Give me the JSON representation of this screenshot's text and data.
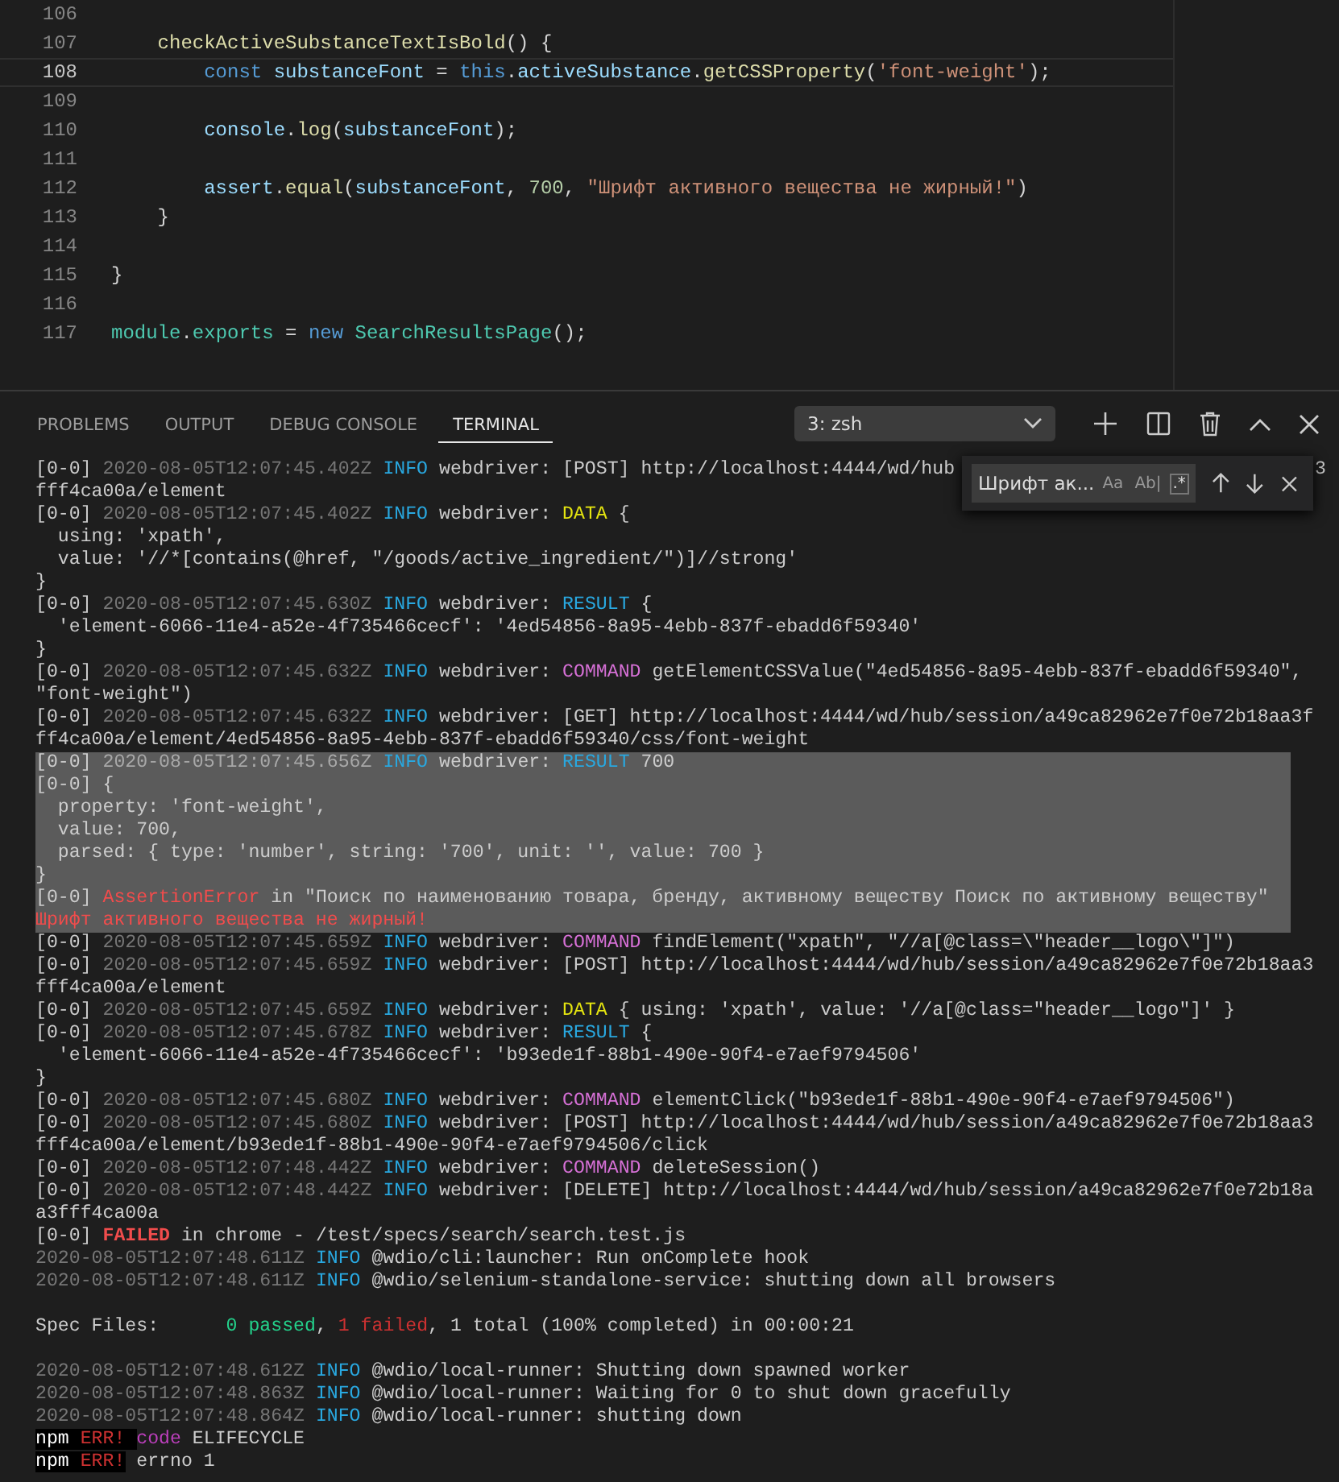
{
  "editor": {
    "lines": [
      {
        "number": "106",
        "current": false
      },
      {
        "number": "107",
        "current": false,
        "tokens": [
          {
            "kind": "fn",
            "text": "    checkActiveSubstanceTextIsBold"
          },
          {
            "kind": "plain",
            "text": "() {"
          }
        ]
      },
      {
        "number": "108",
        "current": true,
        "tokens": [
          {
            "kind": "kw",
            "text": "        const "
          },
          {
            "kind": "var",
            "text": "substanceFont"
          },
          {
            "kind": "plain",
            "text": " = "
          },
          {
            "kind": "kw",
            "text": "this"
          },
          {
            "kind": "plain",
            "text": "."
          },
          {
            "kind": "var",
            "text": "activeSubstance"
          },
          {
            "kind": "plain",
            "text": "."
          },
          {
            "kind": "fn",
            "text": "getCSSProperty"
          },
          {
            "kind": "plain",
            "text": "("
          },
          {
            "kind": "str",
            "text": "'font-weight'"
          },
          {
            "kind": "plain",
            "text": ");"
          }
        ]
      },
      {
        "number": "109",
        "current": false
      },
      {
        "number": "110",
        "current": false,
        "tokens": [
          {
            "kind": "var",
            "text": "        console"
          },
          {
            "kind": "plain",
            "text": "."
          },
          {
            "kind": "fn",
            "text": "log"
          },
          {
            "kind": "plain",
            "text": "("
          },
          {
            "kind": "var",
            "text": "substanceFont"
          },
          {
            "kind": "plain",
            "text": ");"
          }
        ]
      },
      {
        "number": "111",
        "current": false
      },
      {
        "number": "112",
        "current": false,
        "tokens": [
          {
            "kind": "var",
            "text": "        assert"
          },
          {
            "kind": "plain",
            "text": "."
          },
          {
            "kind": "fn",
            "text": "equal"
          },
          {
            "kind": "plain",
            "text": "("
          },
          {
            "kind": "var",
            "text": "substanceFont"
          },
          {
            "kind": "plain",
            "text": ", "
          },
          {
            "kind": "num",
            "text": "700"
          },
          {
            "kind": "plain",
            "text": ", "
          },
          {
            "kind": "str",
            "text": "\"Шрифт активного вещества не жирный!\""
          },
          {
            "kind": "plain",
            "text": ")"
          }
        ]
      },
      {
        "number": "113",
        "current": false,
        "tokens": [
          {
            "kind": "plain",
            "text": "    }"
          }
        ]
      },
      {
        "number": "114",
        "current": false
      },
      {
        "number": "115",
        "current": false,
        "tokens": [
          {
            "kind": "plain",
            "text": "}"
          }
        ]
      },
      {
        "number": "116",
        "current": false
      },
      {
        "number": "117",
        "current": false,
        "tokens": [
          {
            "kind": "cls",
            "text": "module"
          },
          {
            "kind": "plain",
            "text": "."
          },
          {
            "kind": "cls",
            "text": "exports"
          },
          {
            "kind": "plain",
            "text": " = "
          },
          {
            "kind": "kw",
            "text": "new "
          },
          {
            "kind": "cls",
            "text": "SearchResultsPage"
          },
          {
            "kind": "plain",
            "text": "();"
          }
        ]
      }
    ]
  },
  "panel": {
    "tabs": [
      {
        "label": "PROBLEMS",
        "selected": false
      },
      {
        "label": "OUTPUT",
        "selected": false
      },
      {
        "label": "DEBUG CONSOLE",
        "selected": false
      },
      {
        "label": "TERMINAL",
        "selected": true
      }
    ],
    "terminal_select": "3: zsh",
    "find": {
      "value": "Шрифт ак...",
      "options": [
        {
          "label": "Aa",
          "on": false
        },
        {
          "label": "Ab|",
          "on": false
        },
        {
          "label": ".*",
          "on": true
        }
      ]
    },
    "terminal": [
      {
        "kind": "text",
        "highlighted": false,
        "segments": [
          {
            "kind": "plain",
            "text": "[0-0] "
          },
          {
            "kind": "dim",
            "text": "2020-08-05T12:07:45.402Z "
          },
          {
            "kind": "info",
            "text": "INFO"
          },
          {
            "kind": "plain",
            "text": " webdriver: [POST] http://localhost:4444/wd/hub"
          }
        ],
        "tail": "3"
      },
      {
        "kind": "text",
        "highlighted": false,
        "segments": [
          {
            "kind": "plain",
            "text": "fff4ca00a/element"
          }
        ]
      },
      {
        "kind": "text",
        "highlighted": false,
        "segments": [
          {
            "kind": "plain",
            "text": "[0-0] "
          },
          {
            "kind": "dim",
            "text": "2020-08-05T12:07:45.402Z "
          },
          {
            "kind": "info",
            "text": "INFO"
          },
          {
            "kind": "plain",
            "text": " webdriver: "
          },
          {
            "kind": "data",
            "text": "DATA"
          },
          {
            "kind": "plain",
            "text": " {"
          }
        ]
      },
      {
        "kind": "text",
        "highlighted": false,
        "segments": [
          {
            "kind": "plain",
            "text": "  using: 'xpath',"
          }
        ]
      },
      {
        "kind": "text",
        "highlighted": false,
        "segments": [
          {
            "kind": "plain",
            "text": "  value: '//*[contains(@href, \"/goods/active_ingredient/\")]//strong'"
          }
        ]
      },
      {
        "kind": "text",
        "highlighted": false,
        "segments": [
          {
            "kind": "plain",
            "text": "}"
          }
        ]
      },
      {
        "kind": "text",
        "highlighted": false,
        "segments": [
          {
            "kind": "plain",
            "text": "[0-0] "
          },
          {
            "kind": "dim",
            "text": "2020-08-05T12:07:45.630Z "
          },
          {
            "kind": "info",
            "text": "INFO"
          },
          {
            "kind": "plain",
            "text": " webdriver: "
          },
          {
            "kind": "info",
            "text": "RESULT"
          },
          {
            "kind": "plain",
            "text": " {"
          }
        ]
      },
      {
        "kind": "text",
        "highlighted": false,
        "segments": [
          {
            "kind": "plain",
            "text": "  'element-6066-11e4-a52e-4f735466cecf': '4ed54856-8a95-4ebb-837f-ebadd6f59340'"
          }
        ]
      },
      {
        "kind": "text",
        "highlighted": false,
        "segments": [
          {
            "kind": "plain",
            "text": "}"
          }
        ]
      },
      {
        "kind": "text",
        "highlighted": false,
        "segments": [
          {
            "kind": "plain",
            "text": "[0-0] "
          },
          {
            "kind": "dim",
            "text": "2020-08-05T12:07:45.632Z "
          },
          {
            "kind": "info",
            "text": "INFO"
          },
          {
            "kind": "plain",
            "text": " webdriver: "
          },
          {
            "kind": "cmd",
            "text": "COMMAND"
          },
          {
            "kind": "plain",
            "text": " getElementCSSValue(\"4ed54856-8a95-4ebb-837f-ebadd6f59340\","
          }
        ]
      },
      {
        "kind": "text",
        "highlighted": false,
        "segments": [
          {
            "kind": "plain",
            "text": "\"font-weight\")"
          }
        ]
      },
      {
        "kind": "text",
        "highlighted": false,
        "segments": [
          {
            "kind": "plain",
            "text": "[0-0] "
          },
          {
            "kind": "dim",
            "text": "2020-08-05T12:07:45.632Z "
          },
          {
            "kind": "info",
            "text": "INFO"
          },
          {
            "kind": "plain",
            "text": " webdriver: [GET] http://localhost:4444/wd/hub/session/a49ca82962e7f0e72b18aa3f"
          }
        ]
      },
      {
        "kind": "text",
        "highlighted": false,
        "segments": [
          {
            "kind": "plain",
            "text": "ff4ca00a/element/4ed54856-8a95-4ebb-837f-ebadd6f59340/css/font-weight"
          }
        ]
      },
      {
        "kind": "text",
        "highlighted": true,
        "segments": [
          {
            "kind": "plain",
            "text": "[0-0] "
          },
          {
            "kind": "dim",
            "text": "2020-08-05T12:07:45.656Z "
          },
          {
            "kind": "info",
            "text": "INFO"
          },
          {
            "kind": "plain",
            "text": " webdriver: "
          },
          {
            "kind": "info",
            "text": "RESULT"
          },
          {
            "kind": "plain",
            "text": " 700"
          }
        ]
      },
      {
        "kind": "text",
        "highlighted": true,
        "segments": [
          {
            "kind": "plain",
            "text": "[0-0] {"
          }
        ]
      },
      {
        "kind": "text",
        "highlighted": true,
        "segments": [
          {
            "kind": "plain",
            "text": "  property: 'font-weight',"
          }
        ]
      },
      {
        "kind": "text",
        "highlighted": true,
        "segments": [
          {
            "kind": "plain",
            "text": "  value: 700,"
          }
        ]
      },
      {
        "kind": "text",
        "highlighted": true,
        "segments": [
          {
            "kind": "plain",
            "text": "  parsed: { type: 'number', string: '700', unit: '', value: 700 }"
          }
        ]
      },
      {
        "kind": "text",
        "highlighted": true,
        "segments": [
          {
            "kind": "plain",
            "text": "}"
          }
        ]
      },
      {
        "kind": "text",
        "highlighted": true,
        "segments": [
          {
            "kind": "plain",
            "text": "[0-0] "
          },
          {
            "kind": "error",
            "text": "AssertionError"
          },
          {
            "kind": "plain",
            "text": " in \"Поиск по наименованию товара, бренду, активному веществу Поиск по активному веществу\""
          }
        ]
      },
      {
        "kind": "text",
        "highlighted": true,
        "segments": [
          {
            "kind": "error",
            "text": "Шрифт активного вещества не жирный!"
          }
        ]
      },
      {
        "kind": "text",
        "highlighted": false,
        "segments": [
          {
            "kind": "plain",
            "text": "[0-0] "
          },
          {
            "kind": "dim",
            "text": "2020-08-05T12:07:45.659Z "
          },
          {
            "kind": "info",
            "text": "INFO"
          },
          {
            "kind": "plain",
            "text": " webdriver: "
          },
          {
            "kind": "cmd",
            "text": "COMMAND"
          },
          {
            "kind": "plain",
            "text": " findElement(\"xpath\", \"//a[@class=\\\"header__logo\\\"]\")"
          }
        ]
      },
      {
        "kind": "text",
        "highlighted": false,
        "segments": [
          {
            "kind": "plain",
            "text": "[0-0] "
          },
          {
            "kind": "dim",
            "text": "2020-08-05T12:07:45.659Z "
          },
          {
            "kind": "info",
            "text": "INFO"
          },
          {
            "kind": "plain",
            "text": " webdriver: [POST] http://localhost:4444/wd/hub/session/a49ca82962e7f0e72b18aa3"
          }
        ]
      },
      {
        "kind": "text",
        "highlighted": false,
        "segments": [
          {
            "kind": "plain",
            "text": "fff4ca00a/element"
          }
        ]
      },
      {
        "kind": "text",
        "highlighted": false,
        "segments": [
          {
            "kind": "plain",
            "text": "[0-0] "
          },
          {
            "kind": "dim",
            "text": "2020-08-05T12:07:45.659Z "
          },
          {
            "kind": "info",
            "text": "INFO"
          },
          {
            "kind": "plain",
            "text": " webdriver: "
          },
          {
            "kind": "data",
            "text": "DATA"
          },
          {
            "kind": "plain",
            "text": " { using: 'xpath', value: '//a[@class=\"header__logo\"]' }"
          }
        ]
      },
      {
        "kind": "text",
        "highlighted": false,
        "segments": [
          {
            "kind": "plain",
            "text": "[0-0] "
          },
          {
            "kind": "dim",
            "text": "2020-08-05T12:07:45.678Z "
          },
          {
            "kind": "info",
            "text": "INFO"
          },
          {
            "kind": "plain",
            "text": " webdriver: "
          },
          {
            "kind": "info",
            "text": "RESULT"
          },
          {
            "kind": "plain",
            "text": " {"
          }
        ]
      },
      {
        "kind": "text",
        "highlighted": false,
        "segments": [
          {
            "kind": "plain",
            "text": "  'element-6066-11e4-a52e-4f735466cecf': 'b93ede1f-88b1-490e-90f4-e7aef9794506'"
          }
        ]
      },
      {
        "kind": "text",
        "highlighted": false,
        "segments": [
          {
            "kind": "plain",
            "text": "}"
          }
        ]
      },
      {
        "kind": "text",
        "highlighted": false,
        "segments": [
          {
            "kind": "plain",
            "text": "[0-0] "
          },
          {
            "kind": "dim",
            "text": "2020-08-05T12:07:45.680Z "
          },
          {
            "kind": "info",
            "text": "INFO"
          },
          {
            "kind": "plain",
            "text": " webdriver: "
          },
          {
            "kind": "cmd",
            "text": "COMMAND"
          },
          {
            "kind": "plain",
            "text": " elementClick(\"b93ede1f-88b1-490e-90f4-e7aef9794506\")"
          }
        ]
      },
      {
        "kind": "text",
        "highlighted": false,
        "segments": [
          {
            "kind": "plain",
            "text": "[0-0] "
          },
          {
            "kind": "dim",
            "text": "2020-08-05T12:07:45.680Z "
          },
          {
            "kind": "info",
            "text": "INFO"
          },
          {
            "kind": "plain",
            "text": " webdriver: [POST] http://localhost:4444/wd/hub/session/a49ca82962e7f0e72b18aa3"
          }
        ]
      },
      {
        "kind": "text",
        "highlighted": false,
        "segments": [
          {
            "kind": "plain",
            "text": "fff4ca00a/element/b93ede1f-88b1-490e-90f4-e7aef9794506/click"
          }
        ]
      },
      {
        "kind": "text",
        "highlighted": false,
        "segments": [
          {
            "kind": "plain",
            "text": "[0-0] "
          },
          {
            "kind": "dim",
            "text": "2020-08-05T12:07:48.442Z "
          },
          {
            "kind": "info",
            "text": "INFO"
          },
          {
            "kind": "plain",
            "text": " webdriver: "
          },
          {
            "kind": "cmd",
            "text": "COMMAND"
          },
          {
            "kind": "plain",
            "text": " deleteSession()"
          }
        ]
      },
      {
        "kind": "text",
        "highlighted": false,
        "segments": [
          {
            "kind": "plain",
            "text": "[0-0] "
          },
          {
            "kind": "dim",
            "text": "2020-08-05T12:07:48.442Z "
          },
          {
            "kind": "info",
            "text": "INFO"
          },
          {
            "kind": "plain",
            "text": " webdriver: [DELETE] http://localhost:4444/wd/hub/session/a49ca82962e7f0e72b18a"
          }
        ]
      },
      {
        "kind": "text",
        "highlighted": false,
        "segments": [
          {
            "kind": "plain",
            "text": "a3fff4ca00a"
          }
        ]
      },
      {
        "kind": "text",
        "highlighted": false,
        "segments": [
          {
            "kind": "plain",
            "text": "[0-0] "
          },
          {
            "kind": "failed",
            "text": "FAILED"
          },
          {
            "kind": "plain",
            "text": " in chrome - /test/specs/search/search.test.js"
          }
        ]
      },
      {
        "kind": "text",
        "highlighted": false,
        "segments": [
          {
            "kind": "dim",
            "text": "2020-08-05T12:07:48.611Z "
          },
          {
            "kind": "info",
            "text": "INFO"
          },
          {
            "kind": "plain",
            "text": " @wdio/cli:launcher: Run onComplete hook"
          }
        ]
      },
      {
        "kind": "text",
        "highlighted": false,
        "segments": [
          {
            "kind": "dim",
            "text": "2020-08-05T12:07:48.611Z "
          },
          {
            "kind": "info",
            "text": "INFO"
          },
          {
            "kind": "plain",
            "text": " @wdio/selenium-standalone-service: shutting down all browsers"
          }
        ]
      },
      {
        "kind": "blank",
        "highlighted": false
      },
      {
        "kind": "text",
        "highlighted": false,
        "segments": [
          {
            "kind": "plain",
            "text": "Spec Files:      "
          },
          {
            "kind": "pass",
            "text": "0 passed"
          },
          {
            "kind": "plain",
            "text": ", "
          },
          {
            "kind": "fail",
            "text": "1 failed"
          },
          {
            "kind": "plain",
            "text": ", 1 total (100% completed) in 00:00:21"
          }
        ]
      },
      {
        "kind": "blank",
        "highlighted": false
      },
      {
        "kind": "text",
        "highlighted": false,
        "segments": [
          {
            "kind": "dim",
            "text": "2020-08-05T12:07:48.612Z "
          },
          {
            "kind": "info",
            "text": "INFO"
          },
          {
            "kind": "plain",
            "text": " @wdio/local-runner: Shutting down spawned worker"
          }
        ]
      },
      {
        "kind": "text",
        "highlighted": false,
        "segments": [
          {
            "kind": "dim",
            "text": "2020-08-05T12:07:48.863Z "
          },
          {
            "kind": "info",
            "text": "INFO"
          },
          {
            "kind": "plain",
            "text": " @wdio/local-runner: Waiting for 0 to shut down gracefully"
          }
        ]
      },
      {
        "kind": "text",
        "highlighted": false,
        "segments": [
          {
            "kind": "dim",
            "text": "2020-08-05T12:07:48.864Z "
          },
          {
            "kind": "info",
            "text": "INFO"
          },
          {
            "kind": "plain",
            "text": " @wdio/local-runner: shutting down"
          }
        ]
      },
      {
        "kind": "text",
        "highlighted": false,
        "segments": [
          {
            "kind": "npm",
            "text": "npm"
          },
          {
            "kind": "err",
            "text": " ERR! "
          },
          {
            "kind": "magenta",
            "text": "code"
          },
          {
            "kind": "plain",
            "text": " ELIFECYCLE"
          }
        ]
      },
      {
        "kind": "text",
        "highlighted": false,
        "segments": [
          {
            "kind": "npm",
            "text": "npm"
          },
          {
            "kind": "err",
            "text": " ERR!"
          },
          {
            "kind": "plain",
            "text": " errno 1"
          }
        ]
      }
    ]
  }
}
